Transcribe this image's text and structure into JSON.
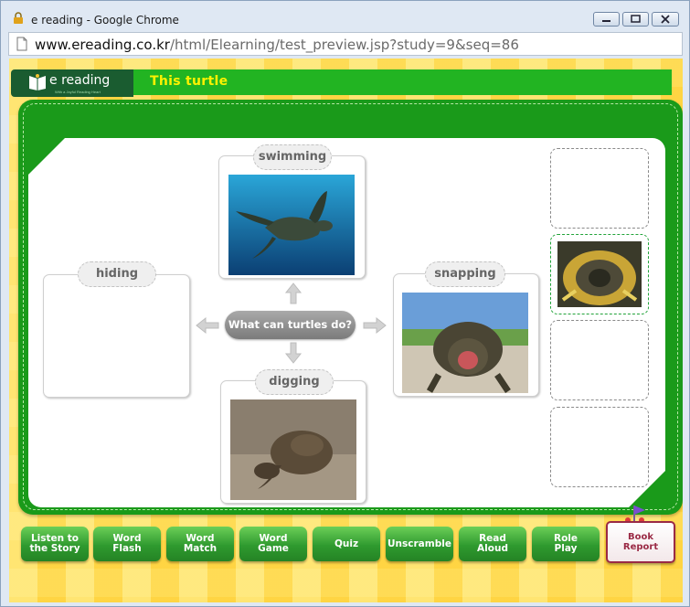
{
  "browser": {
    "window_title": "e reading - Google Chrome",
    "url_domain": "www.ereading.co.kr",
    "url_path": "/html/Elearning/test_preview.jsp?study=9&seq=86"
  },
  "header": {
    "logo_text": "e reading",
    "logo_tagline": "With a Joyful Reading Heart",
    "story_title": "This  turtle"
  },
  "mindmap": {
    "center_question": "What can turtles do?",
    "cards": {
      "top": "swimming",
      "left": "hiding",
      "right": "snapping",
      "bottom": "digging"
    }
  },
  "nav": {
    "buttons": [
      "Listen to\nthe Story",
      "Word\nFlash",
      "Word\nMatch",
      "Word\nGame",
      "Quiz",
      "Unscramble",
      "Read\nAloud",
      "Role\nPlay"
    ],
    "book_report": "Book\nReport"
  },
  "colors": {
    "board_green": "#1a9a1a",
    "title_yellow": "#fff200",
    "book_report_red": "#9a2a45"
  }
}
